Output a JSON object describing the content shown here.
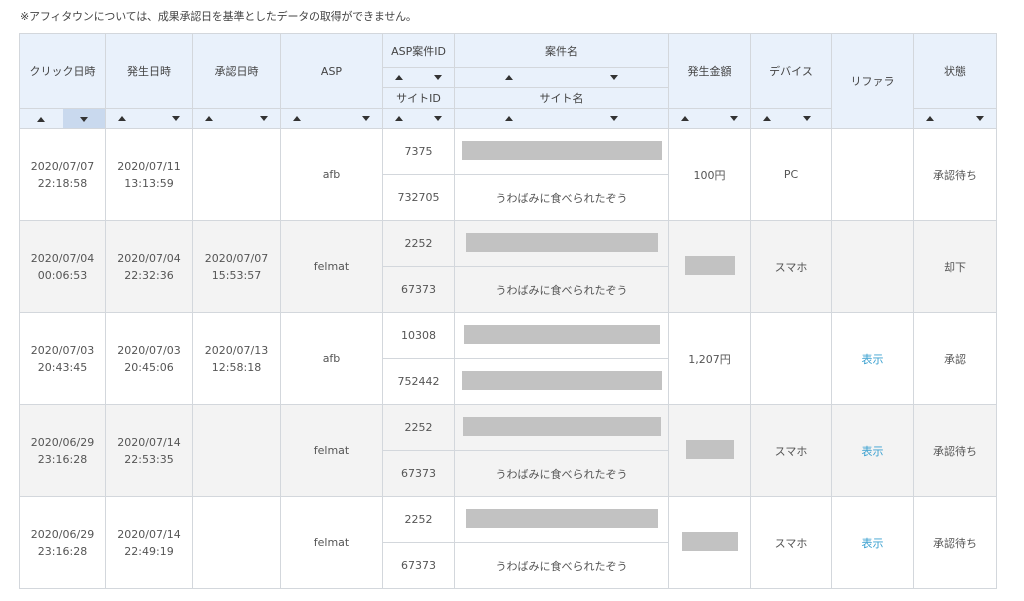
{
  "notice": "※アフィタウンについては、成果承認日を基準としたデータの取得ができません。",
  "headers": {
    "click_date": "クリック日時",
    "occur_date": "発生日時",
    "approve_date": "承認日時",
    "asp": "ASP",
    "asp_case_id": "ASP案件ID",
    "case_name": "案件名",
    "site_id": "サイトID",
    "site_name": "サイト名",
    "amount": "発生金額",
    "device": "デバイス",
    "referrer": "リファラ",
    "status": "状態"
  },
  "rows": [
    {
      "click_date": "2020/07/07",
      "click_time": "22:18:58",
      "occur_date": "2020/07/11",
      "occur_time": "13:13:59",
      "approve_date": "",
      "approve_time": "",
      "asp": "afb",
      "case_id": "7375",
      "site_id": "732705",
      "site_name": "うわばみに食べられたぞう",
      "amount": "100円",
      "device": "PC",
      "referrer": "",
      "status": "承認待ち"
    },
    {
      "click_date": "2020/07/04",
      "click_time": "00:06:53",
      "occur_date": "2020/07/04",
      "occur_time": "22:32:36",
      "approve_date": "2020/07/07",
      "approve_time": "15:53:57",
      "asp": "felmat",
      "case_id": "2252",
      "site_id": "67373",
      "site_name": "うわばみに食べられたぞう",
      "amount": "",
      "device": "スマホ",
      "referrer": "",
      "status": "却下"
    },
    {
      "click_date": "2020/07/03",
      "click_time": "20:43:45",
      "occur_date": "2020/07/03",
      "occur_time": "20:45:06",
      "approve_date": "2020/07/13",
      "approve_time": "12:58:18",
      "asp": "afb",
      "case_id": "10308",
      "site_id": "752442",
      "site_name": "",
      "amount": "1,207円",
      "device": "",
      "referrer": "表示",
      "status": "承認"
    },
    {
      "click_date": "2020/06/29",
      "click_time": "23:16:28",
      "occur_date": "2020/07/14",
      "occur_time": "22:53:35",
      "approve_date": "",
      "approve_time": "",
      "asp": "felmat",
      "case_id": "2252",
      "site_id": "67373",
      "site_name": "うわばみに食べられたぞう",
      "amount": "",
      "device": "スマホ",
      "referrer": "表示",
      "status": "承認待ち"
    },
    {
      "click_date": "2020/06/29",
      "click_time": "23:16:28",
      "occur_date": "2020/07/14",
      "occur_time": "22:49:19",
      "approve_date": "",
      "approve_time": "",
      "asp": "felmat",
      "case_id": "2252",
      "site_id": "67373",
      "site_name": "うわばみに食べられたぞう",
      "amount": "",
      "device": "スマホ",
      "referrer": "表示",
      "status": "承認待ち"
    }
  ],
  "colors": {
    "header_bg": "#e9f1fb",
    "active_sort": "#c9d9ee",
    "row_alt": "#f3f3f3",
    "link": "#3aa0d0",
    "redacted": "#c2c2c2"
  }
}
